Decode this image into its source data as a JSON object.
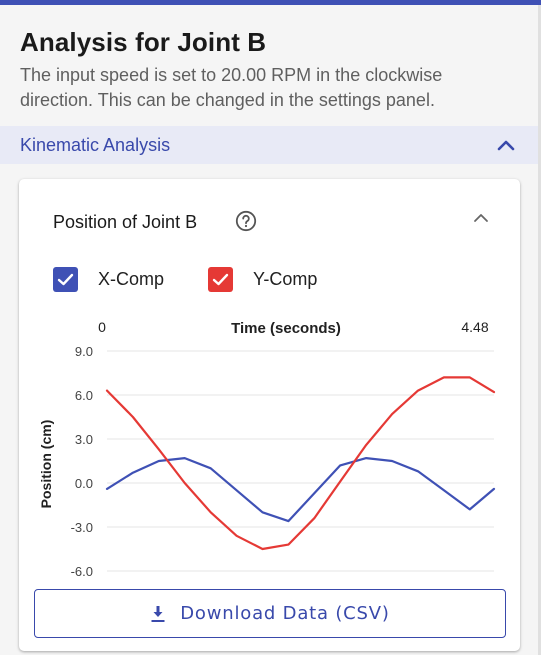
{
  "header": {
    "title": "Analysis for Joint B",
    "subtitle": "The input speed is set to 20.00 RPM in the clockwise direction. This can be changed in the settings panel."
  },
  "section": {
    "title": "Kinematic Analysis"
  },
  "card": {
    "title": "Position of Joint B",
    "download_label": "Download Data (CSV)"
  },
  "colors": {
    "accent": "#3f51b5",
    "x_series": "#3f51b5",
    "y_series": "#e53935"
  },
  "icons": {
    "help": "help-circle-icon",
    "collapse": "chevron-up-icon",
    "download": "download-icon",
    "check": "check-icon"
  },
  "chart_data": {
    "type": "line",
    "xlabel": "Time (seconds)",
    "ylabel": "Position (cm)",
    "x_tick_labels": [
      "0",
      "4.48"
    ],
    "xlim": [
      0,
      4.48
    ],
    "ylim": [
      -6.0,
      9.0
    ],
    "y_ticks": [
      9.0,
      6.0,
      3.0,
      0.0,
      -3.0,
      -6.0
    ],
    "y_tick_labels": [
      "9.0",
      "6.0",
      "3.0",
      "0.0",
      "-3.0",
      "-6.0"
    ],
    "grid": true,
    "x": [
      0,
      0.3,
      0.6,
      0.9,
      1.2,
      1.5,
      1.8,
      2.1,
      2.4,
      2.7,
      3.0,
      3.3,
      3.6,
      3.9,
      4.2,
      4.48
    ],
    "series": [
      {
        "name": "X-Comp",
        "color": "#3f51b5",
        "checked": true,
        "values": [
          -0.4,
          0.7,
          1.5,
          1.7,
          1.0,
          -0.5,
          -2.0,
          -2.6,
          -0.7,
          1.2,
          1.7,
          1.5,
          0.8,
          -0.5,
          -1.8,
          -0.4
        ]
      },
      {
        "name": "Y-Comp",
        "color": "#e53935",
        "checked": true,
        "values": [
          6.3,
          4.5,
          2.3,
          0.0,
          -2.0,
          -3.6,
          -4.5,
          -4.2,
          -2.4,
          0.1,
          2.6,
          4.7,
          6.3,
          7.2,
          7.2,
          6.2
        ]
      }
    ]
  }
}
